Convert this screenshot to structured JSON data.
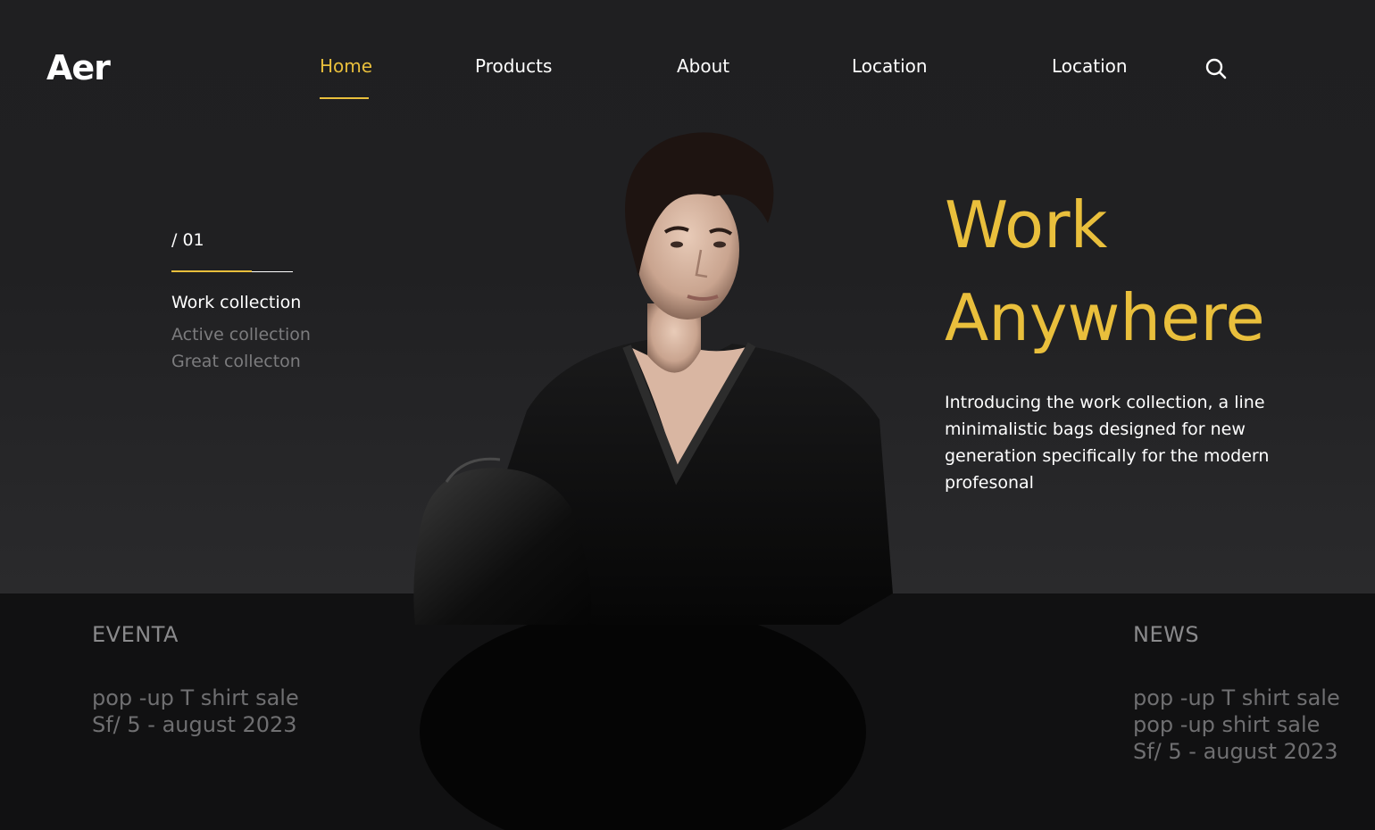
{
  "brand": {
    "logo_text": "Aer"
  },
  "nav": {
    "items": [
      {
        "label": "Home",
        "active": true
      },
      {
        "label": "Products"
      },
      {
        "label": "About"
      },
      {
        "label": "Location"
      },
      {
        "label": "Location"
      }
    ],
    "search_icon": "search-icon"
  },
  "slider": {
    "index_label": "/ 01",
    "collections": [
      {
        "label": "Work collection",
        "active": true
      },
      {
        "label": "Active collection"
      },
      {
        "label": "Great collecton"
      }
    ]
  },
  "hero": {
    "headline_line1": "Work",
    "headline_line2": "Anywhere",
    "intro": "Introducing the work collection, a line minimalistic bags designed for new generation specifically for the modern profesonal"
  },
  "events": {
    "title": "EVENTA",
    "lines": [
      "pop -up T shirt sale",
      "Sf/ 5 - august 2023"
    ]
  },
  "news": {
    "title": "NEWS",
    "lines": [
      "pop -up T shirt sale",
      "pop -up shirt sale",
      "Sf/ 5 - august 2023"
    ]
  },
  "colors": {
    "accent": "#e9bf3c",
    "background": "#1f1f21",
    "bottom_band": "#111112"
  }
}
